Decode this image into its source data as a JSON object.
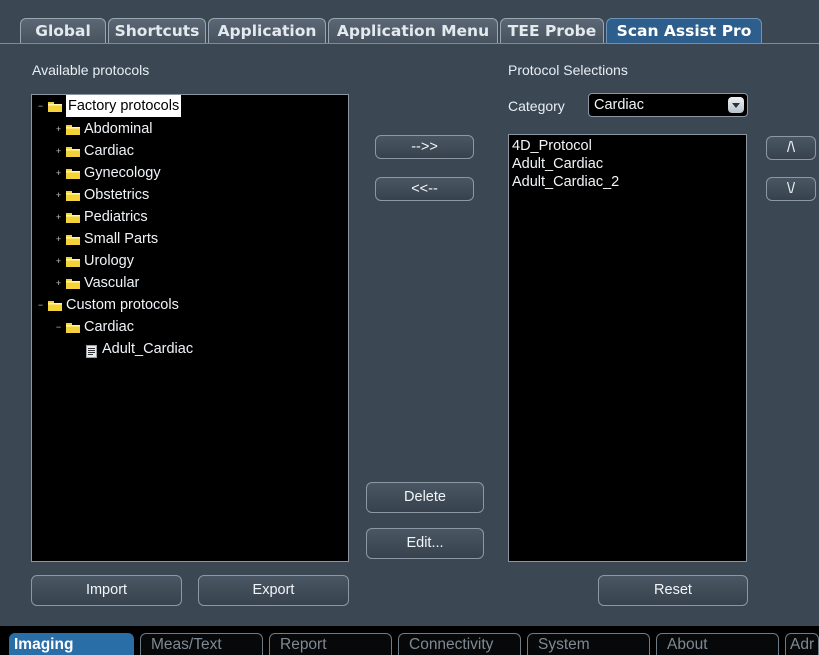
{
  "top_tabs": [
    {
      "label": "Global"
    },
    {
      "label": "Shortcuts"
    },
    {
      "label": "Application"
    },
    {
      "label": "Application Menu"
    },
    {
      "label": "TEE Probe"
    },
    {
      "label": "Scan Assist Pro",
      "active": true
    }
  ],
  "available": {
    "title": "Available protocols",
    "tree": [
      {
        "label": "Factory protocols",
        "expander": "−",
        "selected": true
      },
      {
        "label": "Abdominal",
        "expander": "+"
      },
      {
        "label": "Cardiac",
        "expander": "+"
      },
      {
        "label": "Gynecology",
        "expander": "+"
      },
      {
        "label": "Obstetrics",
        "expander": "+"
      },
      {
        "label": "Pediatrics",
        "expander": "+"
      },
      {
        "label": "Small Parts",
        "expander": "+"
      },
      {
        "label": "Urology",
        "expander": "+"
      },
      {
        "label": "Vascular",
        "expander": "+"
      },
      {
        "label": "Custom protocols",
        "expander": "−"
      },
      {
        "label": "Cardiac",
        "expander": "−"
      },
      {
        "label": "Adult_Cardiac"
      }
    ],
    "import_label": "Import",
    "export_label": "Export"
  },
  "middle": {
    "add_label": "-->>",
    "remove_label": "<<--",
    "delete_label": "Delete",
    "edit_label": "Edit..."
  },
  "selections": {
    "title": "Protocol Selections",
    "category_label": "Category",
    "category_value": "Cardiac",
    "items": [
      "4D_Protocol",
      "Adult_Cardiac",
      "Adult_Cardiac_2"
    ],
    "up_label": "/\\",
    "down_label": "\\/",
    "reset_label": "Reset"
  },
  "bottom_tabs": [
    {
      "label": "Imaging",
      "active": true
    },
    {
      "label": "Meas/Text"
    },
    {
      "label": "Report"
    },
    {
      "label": "Connectivity"
    },
    {
      "label": "System"
    },
    {
      "label": "About"
    },
    {
      "label": "Adr"
    }
  ],
  "colors": {
    "panel_bg": "#3b4854",
    "active_tab": "#2e5f8c",
    "bottom_active_tab": "#2a6ea8",
    "folder_yellow": "#f4d23a"
  }
}
